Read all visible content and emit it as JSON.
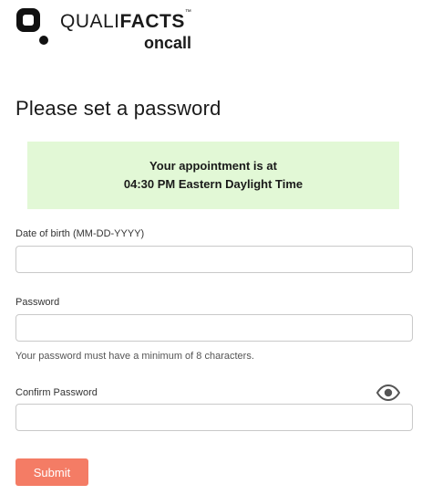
{
  "logo": {
    "word_light": "QUALI",
    "word_bold": "FACTS",
    "trademark": "™",
    "sub": "oncall"
  },
  "title": "Please set a password",
  "notice": {
    "line1": "Your appointment is at",
    "line2": "04:30 PM Eastern Daylight Time",
    "background": "#e2f8d6"
  },
  "form": {
    "dob": {
      "label": "Date of birth (MM-DD-YYYY)",
      "value": "",
      "placeholder": ""
    },
    "password": {
      "label": "Password",
      "value": "",
      "placeholder": "",
      "hint": "Your password must have a minimum of 8 characters."
    },
    "confirm": {
      "label": "Confirm Password",
      "value": "",
      "placeholder": "",
      "icon": "eye-icon"
    },
    "submit_label": "Submit",
    "submit_color": "#f47c65"
  }
}
